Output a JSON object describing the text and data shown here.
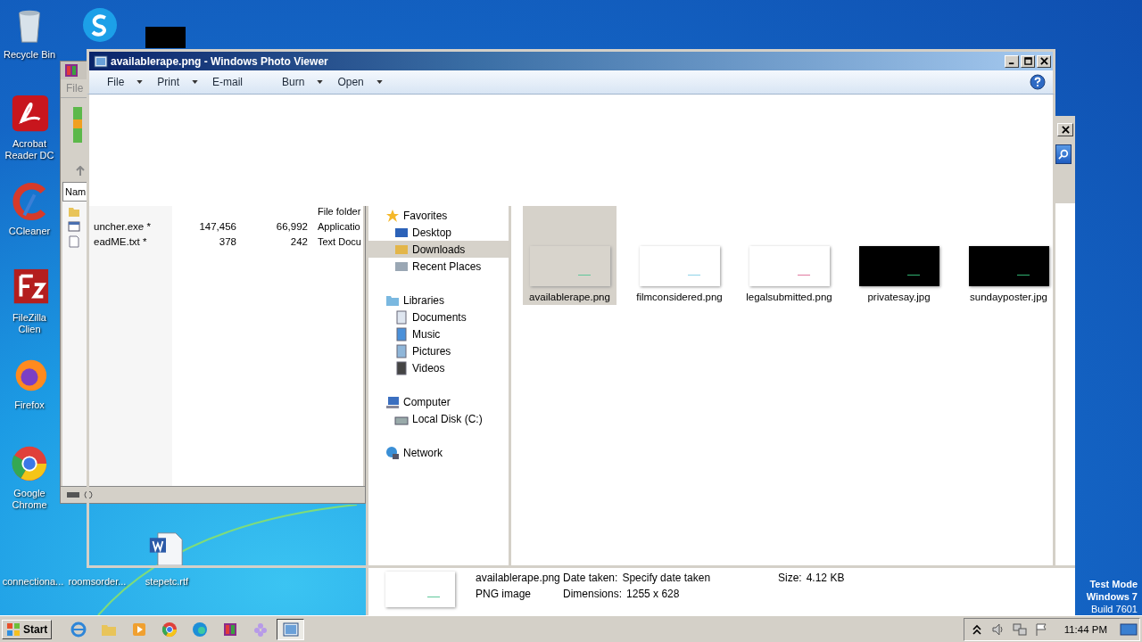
{
  "desktop": {
    "icons": [
      {
        "label": "Recycle Bin"
      },
      {
        "label": "Acrobat Reader DC"
      },
      {
        "label": "CCleaner"
      },
      {
        "label": "FileZilla Clien"
      },
      {
        "label": "Firefox"
      },
      {
        "label": "Google Chrome"
      }
    ],
    "files": [
      {
        "label": "connectiona..."
      },
      {
        "label": "roomsorder..."
      },
      {
        "label": "stepetc.rtf"
      }
    ],
    "system_text": [
      "Test Mode",
      "Windows 7",
      "Build 7601"
    ]
  },
  "archive_window": {
    "menu": "File",
    "column_1": "Nam",
    "rows": [
      {
        "type": "File folder"
      },
      {
        "name": "uncher.exe *",
        "size": "147,456",
        "packed": "66,992",
        "type": "Applicatio"
      },
      {
        "name": "eadME.txt *",
        "size": "378",
        "packed": "242",
        "type": "Text Docu"
      }
    ]
  },
  "photo_viewer": {
    "title": "availablerape.png - Windows Photo Viewer",
    "menu": [
      {
        "label": "File",
        "dropdown": true
      },
      {
        "label": "Print",
        "dropdown": true
      },
      {
        "label": "E-mail",
        "dropdown": false
      },
      {
        "label": "Burn",
        "dropdown": true
      },
      {
        "label": "Open",
        "dropdown": true
      }
    ]
  },
  "explorer": {
    "navigation": [
      {
        "label": "Favorites",
        "children": [
          {
            "label": "Desktop",
            "selected": false
          },
          {
            "label": "Downloads",
            "selected": true
          },
          {
            "label": "Recent Places",
            "selected": false
          }
        ]
      },
      {
        "label": "Libraries",
        "children": [
          {
            "label": "Documents",
            "selected": false
          },
          {
            "label": "Music",
            "selected": false
          },
          {
            "label": "Pictures",
            "selected": false
          },
          {
            "label": "Videos",
            "selected": false
          }
        ]
      },
      {
        "label": "Computer",
        "children": [
          {
            "label": "Local Disk (C:)",
            "selected": false
          }
        ]
      },
      {
        "label": "Network"
      }
    ],
    "files": [
      {
        "name": "availablerape.png",
        "kind": "light",
        "selected": true
      },
      {
        "name": "filmconsidered.png",
        "kind": "light",
        "selected": false
      },
      {
        "name": "legalsubmitted.png",
        "kind": "light",
        "selected": false
      },
      {
        "name": "privatesay.jpg",
        "kind": "dark",
        "selected": false
      },
      {
        "name": "sundayposter.jpg",
        "kind": "dark",
        "selected": false
      }
    ],
    "details": {
      "name": "availablerape.png",
      "type": "PNG image",
      "fields": [
        {
          "label": "Date taken:",
          "value": "Specify date taken"
        },
        {
          "label": "Dimensions:",
          "value": "1255 x 628"
        },
        {
          "label": "Size:",
          "value": "4.12 KB"
        }
      ]
    }
  },
  "taskbar": {
    "start": "Start",
    "apps": [
      {
        "selected": false
      },
      {
        "selected": false
      },
      {
        "selected": false
      },
      {
        "selected": false
      },
      {
        "selected": false
      },
      {
        "selected": false
      },
      {
        "selected": false
      },
      {
        "selected": true
      }
    ],
    "clock": "11:44 PM"
  }
}
